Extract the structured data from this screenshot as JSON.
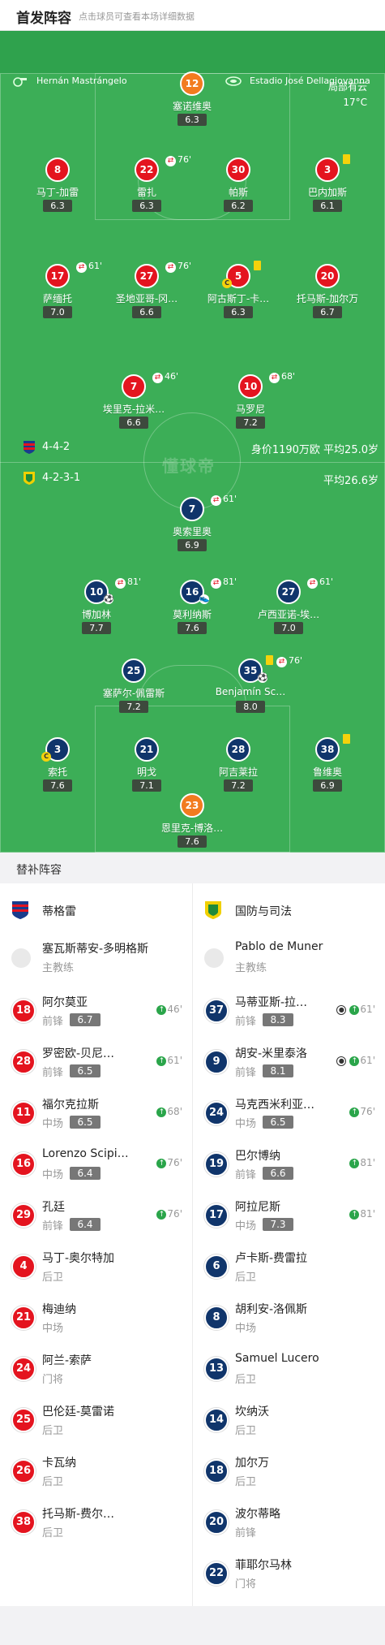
{
  "header": {
    "title": "首发阵容",
    "hint": "点击球员可查看本场详细数据"
  },
  "pitch": {
    "referee": "Hernán Mastrángelo",
    "stadium": "Estadio José Dellagiovanna",
    "weather": "局部有云",
    "temp": "17°C",
    "home_formation": "4-4-2",
    "home_value": "身价1190万欧  平均25.0岁",
    "away_formation": "4-2-3-1",
    "away_value": "平均26.6岁",
    "watermark": "懂球帝",
    "home": [
      {
        "num": "12",
        "name": "塞诺维奥",
        "rating": "6.3"
      },
      {
        "num": "8",
        "name": "马丁-加雷",
        "rating": "6.3"
      },
      {
        "num": "22",
        "name": "雷扎",
        "rating": "6.3",
        "sub": "76'"
      },
      {
        "num": "30",
        "name": "帕斯",
        "rating": "6.2"
      },
      {
        "num": "3",
        "name": "巴内加斯",
        "rating": "6.1"
      },
      {
        "num": "17",
        "name": "萨缅托",
        "rating": "7.0",
        "sub": "61'"
      },
      {
        "num": "27",
        "name": "圣地亚哥-冈…",
        "rating": "6.6",
        "sub": "76'"
      },
      {
        "num": "5",
        "name": "阿古斯丁-卡…",
        "rating": "6.3"
      },
      {
        "num": "20",
        "name": "托马斯-加尔万",
        "rating": "6.7"
      },
      {
        "num": "7",
        "name": "埃里克-拉米…",
        "rating": "6.6",
        "sub": "46'"
      },
      {
        "num": "10",
        "name": "马罗尼",
        "rating": "7.2",
        "sub": "68'"
      }
    ],
    "away": [
      {
        "num": "7",
        "name": "奥索里奥",
        "rating": "6.9",
        "sub": "61'"
      },
      {
        "num": "10",
        "name": "博加林",
        "rating": "7.7",
        "sub": "81'"
      },
      {
        "num": "16",
        "name": "莫利纳斯",
        "rating": "7.6",
        "sub": "81'"
      },
      {
        "num": "27",
        "name": "卢西亚诺-埃…",
        "rating": "7.0",
        "sub": "61'"
      },
      {
        "num": "25",
        "name": "塞萨尔-佩雷斯",
        "rating": "7.2"
      },
      {
        "num": "35",
        "name": "Benjamín Sc…",
        "rating": "8.0",
        "sub": "76'"
      },
      {
        "num": "3",
        "name": "索托",
        "rating": "7.6"
      },
      {
        "num": "21",
        "name": "明戈",
        "rating": "7.1"
      },
      {
        "num": "28",
        "name": "阿吉莱拉",
        "rating": "7.2"
      },
      {
        "num": "38",
        "name": "鲁维奥",
        "rating": "6.9"
      },
      {
        "num": "23",
        "name": "恩里克-博洛…",
        "rating": "7.6"
      }
    ]
  },
  "subs": {
    "title": "替补阵容",
    "home_team": "蒂格雷",
    "away_team": "国防与司法",
    "home_coach": {
      "name": "塞瓦斯蒂安-多明格斯",
      "role": "主教练"
    },
    "away_coach": {
      "name": "Pablo de Muner",
      "role": "主教练"
    },
    "home": [
      {
        "num": "18",
        "name": "阿尔莫亚",
        "pos": "前锋",
        "rating": "6.7",
        "in": "46'"
      },
      {
        "num": "28",
        "name": "罗密欧-贝尼…",
        "pos": "前锋",
        "rating": "6.5",
        "in": "61'"
      },
      {
        "num": "11",
        "name": "福尔克拉斯",
        "pos": "中场",
        "rating": "6.5",
        "in": "68'"
      },
      {
        "num": "16",
        "name": "Lorenzo Scipi…",
        "pos": "中场",
        "rating": "6.4",
        "in": "76'"
      },
      {
        "num": "29",
        "name": "孔廷",
        "pos": "前锋",
        "rating": "6.4",
        "in": "76'"
      },
      {
        "num": "4",
        "name": "马丁-奥尔特加",
        "pos": "后卫"
      },
      {
        "num": "21",
        "name": "梅迪纳",
        "pos": "中场"
      },
      {
        "num": "24",
        "name": "阿兰-索萨",
        "pos": "门将"
      },
      {
        "num": "25",
        "name": "巴伦廷-莫雷诺",
        "pos": "后卫"
      },
      {
        "num": "26",
        "name": "卡瓦纳",
        "pos": "后卫"
      },
      {
        "num": "38",
        "name": "托马斯-费尔…",
        "pos": "后卫"
      }
    ],
    "away": [
      {
        "num": "37",
        "name": "马蒂亚斯-拉…",
        "pos": "前锋",
        "rating": "8.3",
        "in": "61'",
        "goal": true
      },
      {
        "num": "9",
        "name": "胡安-米里泰洛",
        "pos": "前锋",
        "rating": "8.1",
        "in": "61'",
        "goal": true
      },
      {
        "num": "24",
        "name": "马克西米利亚…",
        "pos": "中场",
        "rating": "6.5",
        "in": "76'"
      },
      {
        "num": "19",
        "name": "巴尔博纳",
        "pos": "前锋",
        "rating": "6.6",
        "in": "81'"
      },
      {
        "num": "17",
        "name": "阿拉尼斯",
        "pos": "中场",
        "rating": "7.3",
        "in": "81'"
      },
      {
        "num": "6",
        "name": "卢卡斯-费雷拉",
        "pos": "后卫"
      },
      {
        "num": "8",
        "name": "胡利安-洛佩斯",
        "pos": "中场"
      },
      {
        "num": "13",
        "name": "Samuel Lucero",
        "pos": "后卫"
      },
      {
        "num": "14",
        "name": "坎纳沃",
        "pos": "后卫"
      },
      {
        "num": "18",
        "name": "加尔万",
        "pos": "后卫"
      },
      {
        "num": "20",
        "name": "波尔蒂略",
        "pos": "前锋"
      },
      {
        "num": "22",
        "name": "菲耶尔马林",
        "pos": "门将"
      }
    ]
  }
}
